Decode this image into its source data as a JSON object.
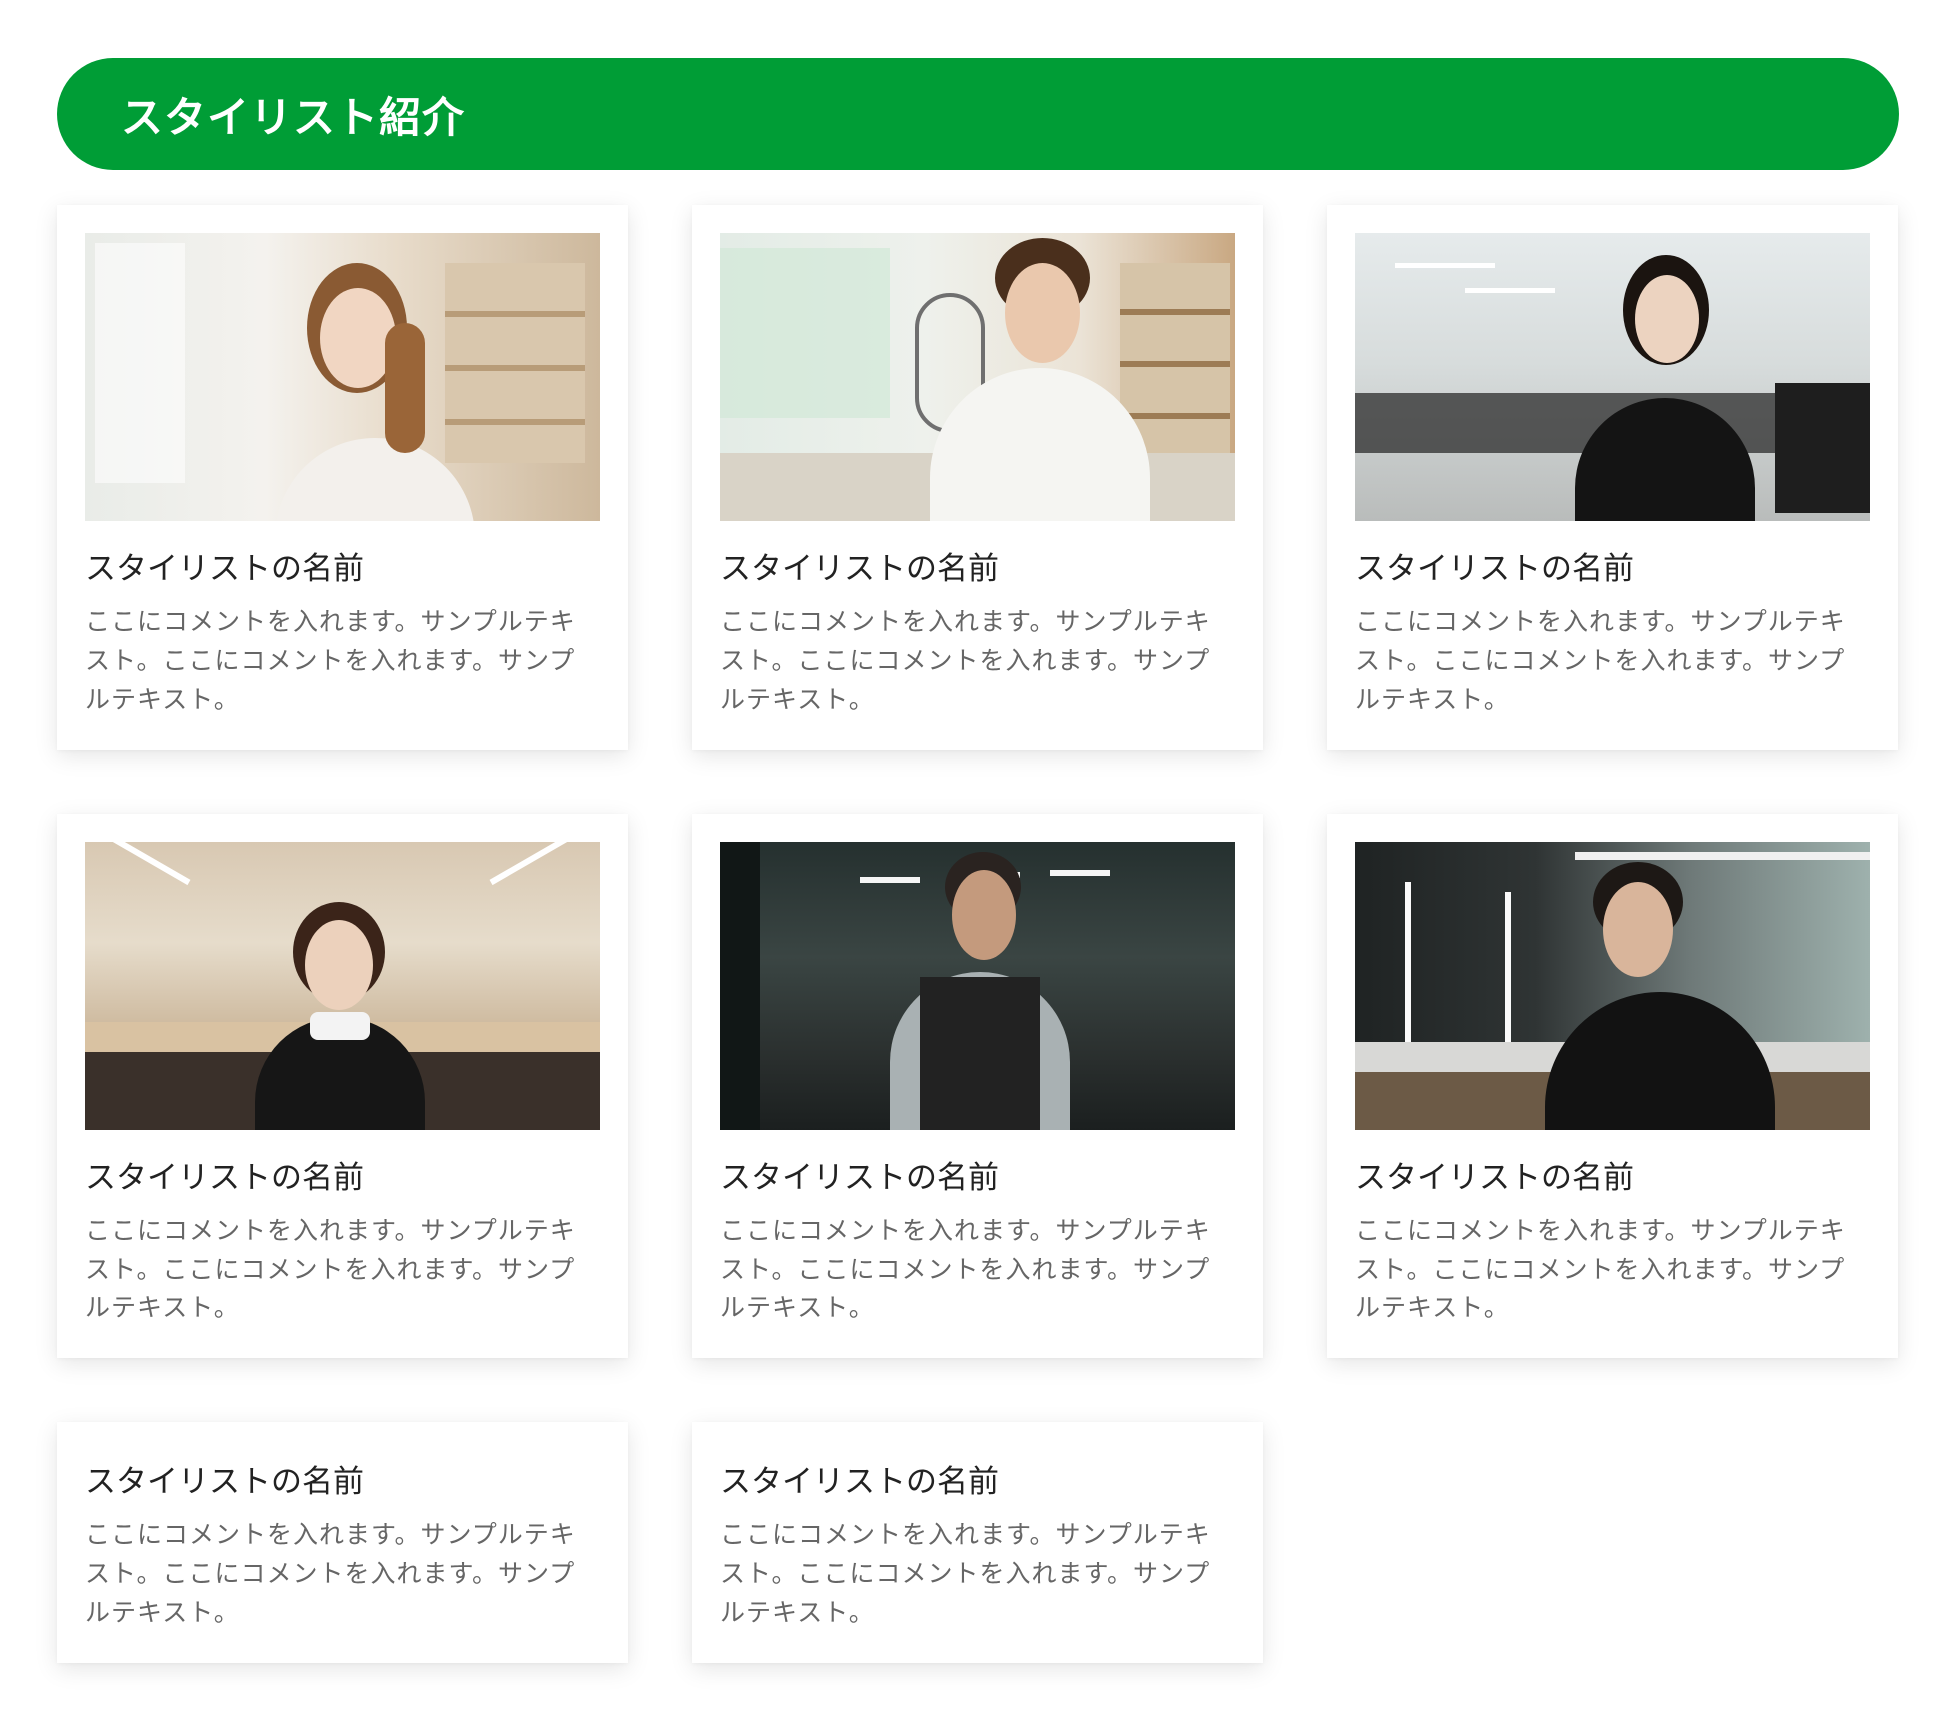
{
  "section": {
    "title": "スタイリスト紹介"
  },
  "stylists": [
    {
      "name": "スタイリストの名前",
      "comment": "ここにコメントを入れます。サンプルテキスト。ここにコメントを入れます。サンプルテキスト。",
      "has_photo": true
    },
    {
      "name": "スタイリストの名前",
      "comment": "ここにコメントを入れます。サンプルテキスト。ここにコメントを入れます。サンプルテキスト。",
      "has_photo": true
    },
    {
      "name": "スタイリストの名前",
      "comment": "ここにコメントを入れます。サンプルテキスト。ここにコメントを入れます。サンプルテキスト。",
      "has_photo": true
    },
    {
      "name": "スタイリストの名前",
      "comment": "ここにコメントを入れます。サンプルテキスト。ここにコメントを入れます。サンプルテキスト。",
      "has_photo": true
    },
    {
      "name": "スタイリストの名前",
      "comment": "ここにコメントを入れます。サンプルテキスト。ここにコメントを入れます。サンプルテキスト。",
      "has_photo": true
    },
    {
      "name": "スタイリストの名前",
      "comment": "ここにコメントを入れます。サンプルテキスト。ここにコメントを入れます。サンプルテキスト。",
      "has_photo": true
    },
    {
      "name": "スタイリストの名前",
      "comment": "ここにコメントを入れます。サンプルテキスト。ここにコメントを入れます。サンプルテキスト。",
      "has_photo": false
    },
    {
      "name": "スタイリストの名前",
      "comment": "ここにコメントを入れます。サンプルテキスト。ここにコメントを入れます。サンプルテキスト。",
      "has_photo": false
    }
  ],
  "colors": {
    "accent": "#009d36"
  }
}
